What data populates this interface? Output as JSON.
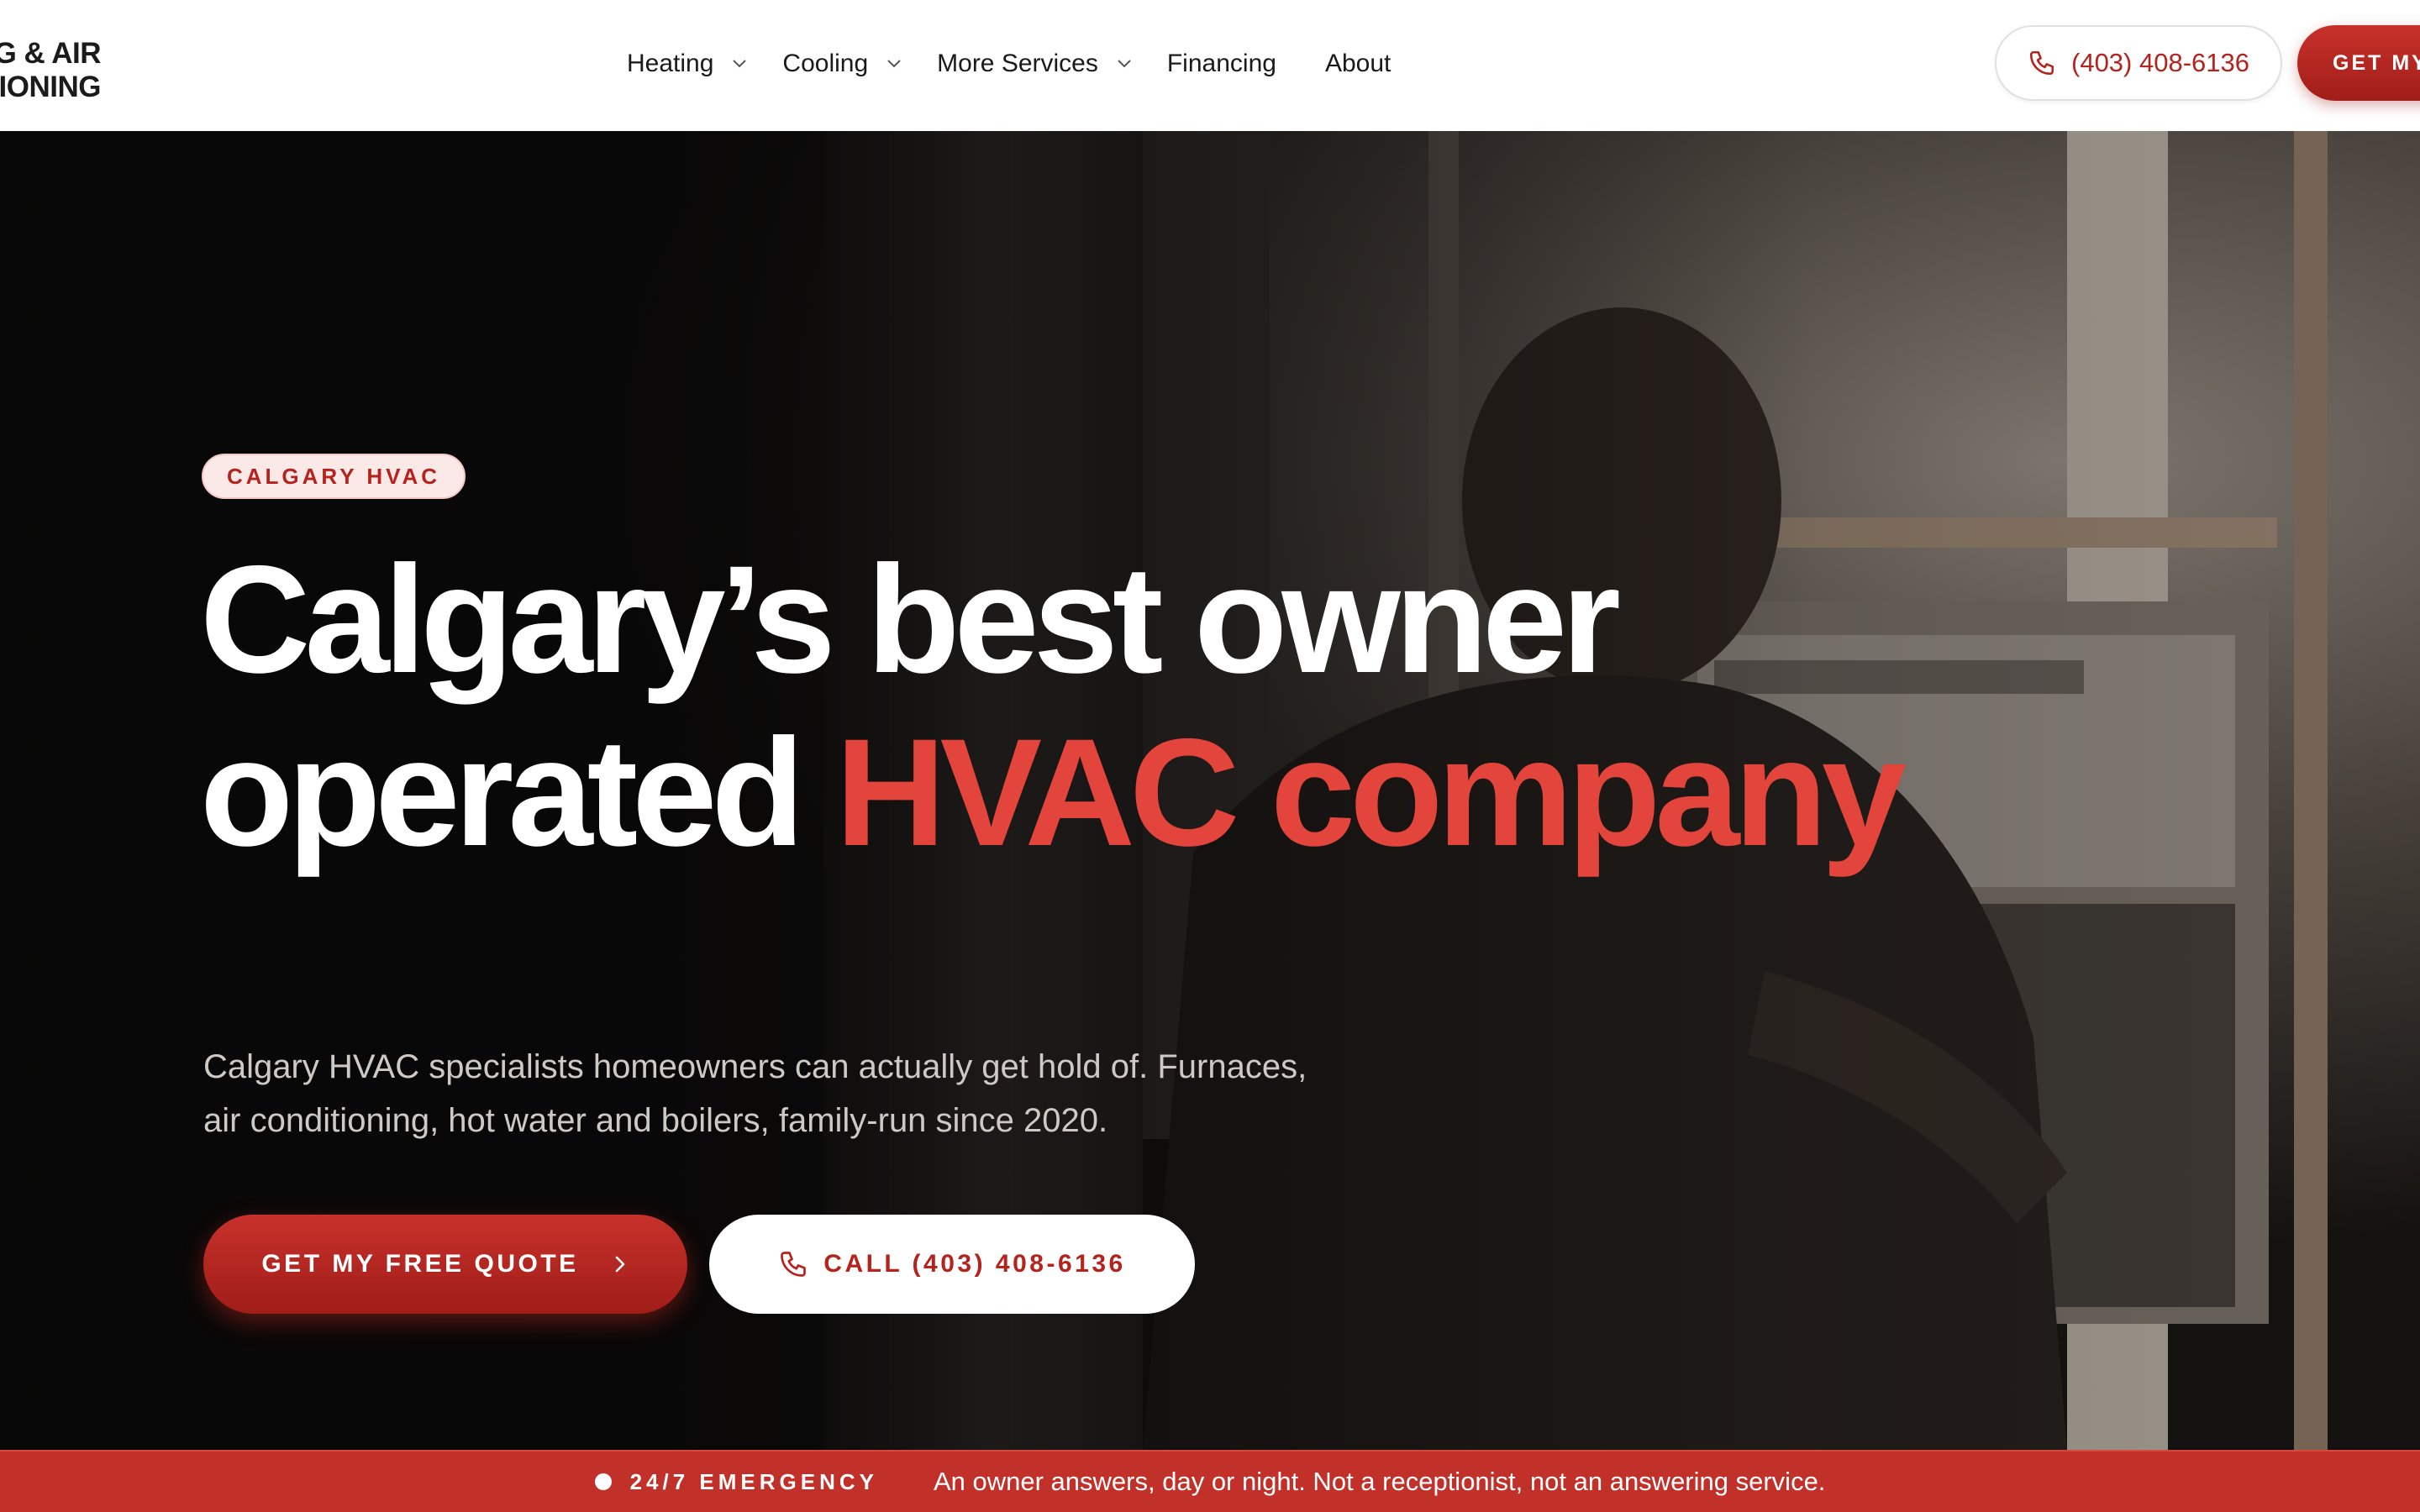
{
  "header": {
    "logo_line1": "G & AIR",
    "logo_line2": "IONING",
    "nav": [
      {
        "label": "Heating",
        "has_menu": true
      },
      {
        "label": "Cooling",
        "has_menu": true
      },
      {
        "label": "More Services",
        "has_menu": true
      },
      {
        "label": "Financing",
        "has_menu": false
      },
      {
        "label": "About",
        "has_menu": false
      }
    ],
    "phone": "(403) 408-6136",
    "cta": "GET MY"
  },
  "hero": {
    "badge": "CALGARY HVAC",
    "headline_line1": "Calgary’s best owner",
    "headline_line2_white": "operated",
    "headline_line2_accent": "HVAC company",
    "subtext_line1": "Calgary HVAC specialists homeowners can actually get hold of. Furnaces,",
    "subtext_line2": "air conditioning, hot water and boilers, family-run since 2020.",
    "cta_primary": "GET MY FREE QUOTE",
    "cta_secondary": "CALL (403) 408-6136"
  },
  "strip": {
    "tag": "24/7 EMERGENCY",
    "text": "An owner answers, day or night. Not a receptionist, not an answering service."
  },
  "icons": {
    "phone": "phone-icon",
    "chevron_down": "chevron-down-icon",
    "chevron_right": "chevron-right-icon"
  },
  "colors": {
    "brand_red": "#c2302a",
    "accent_red": "#e3443b",
    "badge_bg": "#fbe9e8",
    "hero_bg": "#0c0b0b"
  }
}
